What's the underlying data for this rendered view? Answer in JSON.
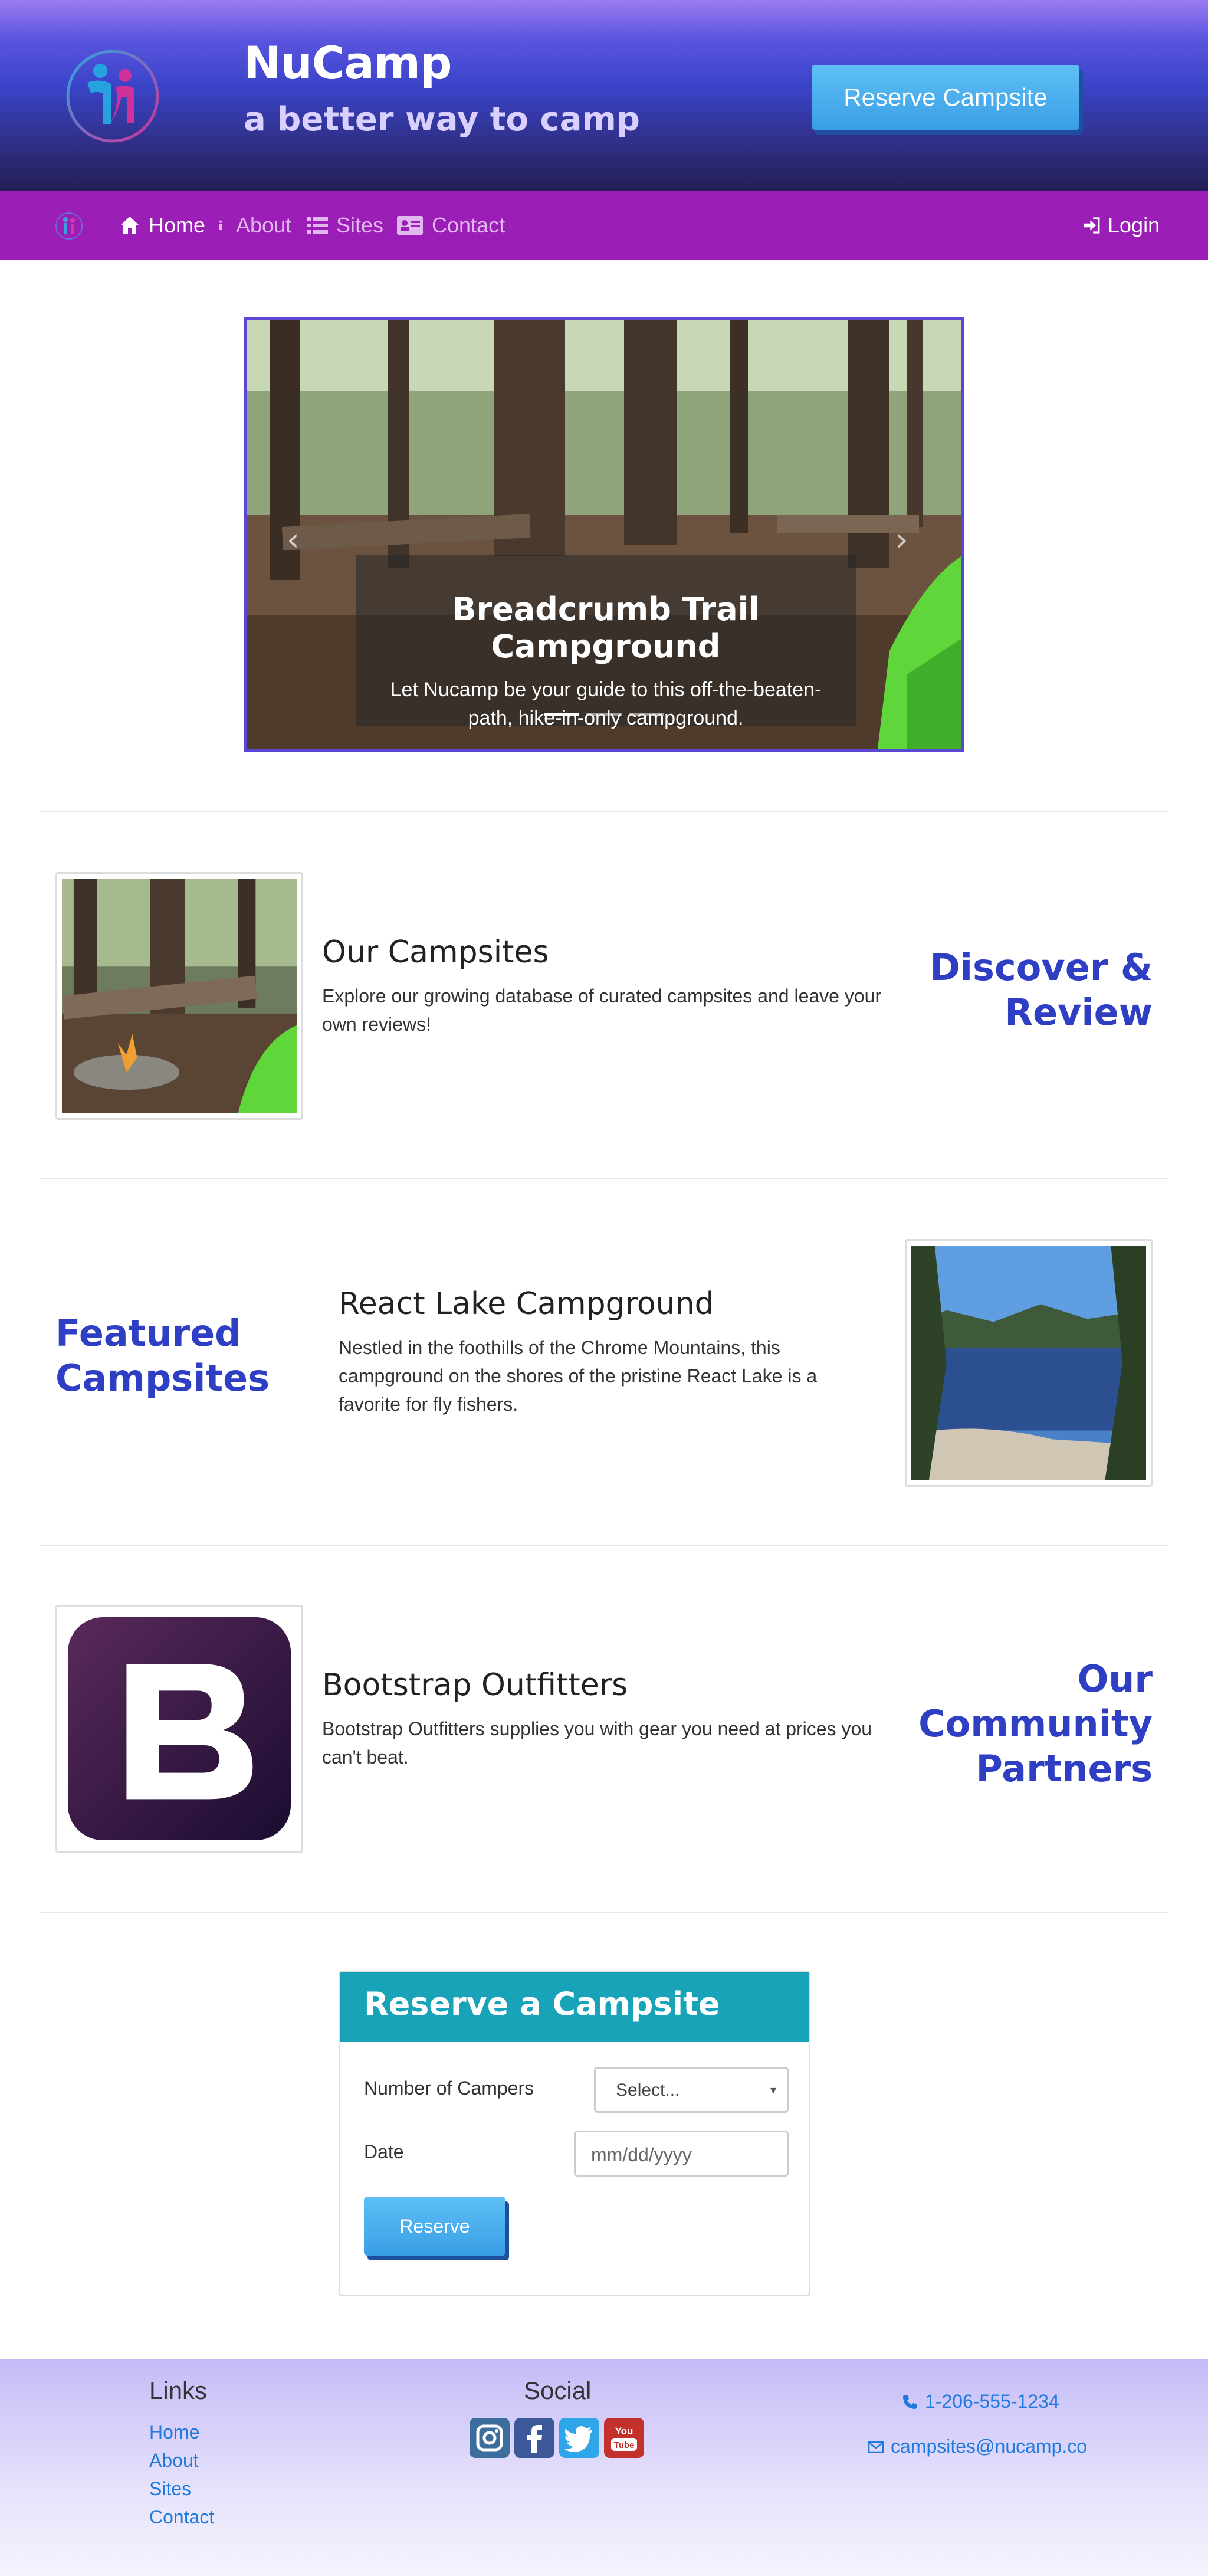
{
  "header": {
    "brand": "NuCamp",
    "tagline": "a better way to camp",
    "reserve_button": "Reserve Campsite"
  },
  "nav": {
    "items": [
      {
        "label": "Home",
        "icon": "home-icon",
        "active": true
      },
      {
        "label": "About",
        "icon": "info-icon",
        "active": false
      },
      {
        "label": "Sites",
        "icon": "list-icon",
        "active": false
      },
      {
        "label": "Contact",
        "icon": "address-card-icon",
        "active": false
      }
    ],
    "login": "Login"
  },
  "carousel": {
    "title": "Breadcrumb Trail Campground",
    "text": "Let Nucamp be your guide to this off-the-beaten-path, hike-in-only campground.",
    "indicators": 3,
    "active_index": 0
  },
  "sections": {
    "campsites": {
      "heading": "Our Campsites",
      "text": "Explore our growing database of curated campsites and leave your own reviews!",
      "side_title": "Discover & Review"
    },
    "featured": {
      "side_title": "Featured Campsites",
      "heading": "React Lake Campground",
      "text": "Nestled in the foothills of the Chrome Mountains, this campground on the shores of the pristine React Lake is a favorite for fly fishers."
    },
    "partners": {
      "heading": "Bootstrap Outfitters",
      "text": "Bootstrap Outfitters supplies you with gear you need at prices you can't beat.",
      "side_title": "Our Community Partners"
    }
  },
  "reserve_form": {
    "title": "Reserve a Campsite",
    "campers_label": "Number of Campers",
    "campers_value": "Select...",
    "date_label": "Date",
    "date_placeholder": "mm/dd/yyyy",
    "submit": "Reserve"
  },
  "footer": {
    "links_heading": "Links",
    "links": [
      "Home",
      "About",
      "Sites",
      "Contact"
    ],
    "social_heading": "Social",
    "social": [
      "instagram-icon",
      "facebook-icon",
      "twitter-icon",
      "youtube-icon"
    ],
    "phone": "1-206-555-1234",
    "email": "campsites@nucamp.co"
  }
}
